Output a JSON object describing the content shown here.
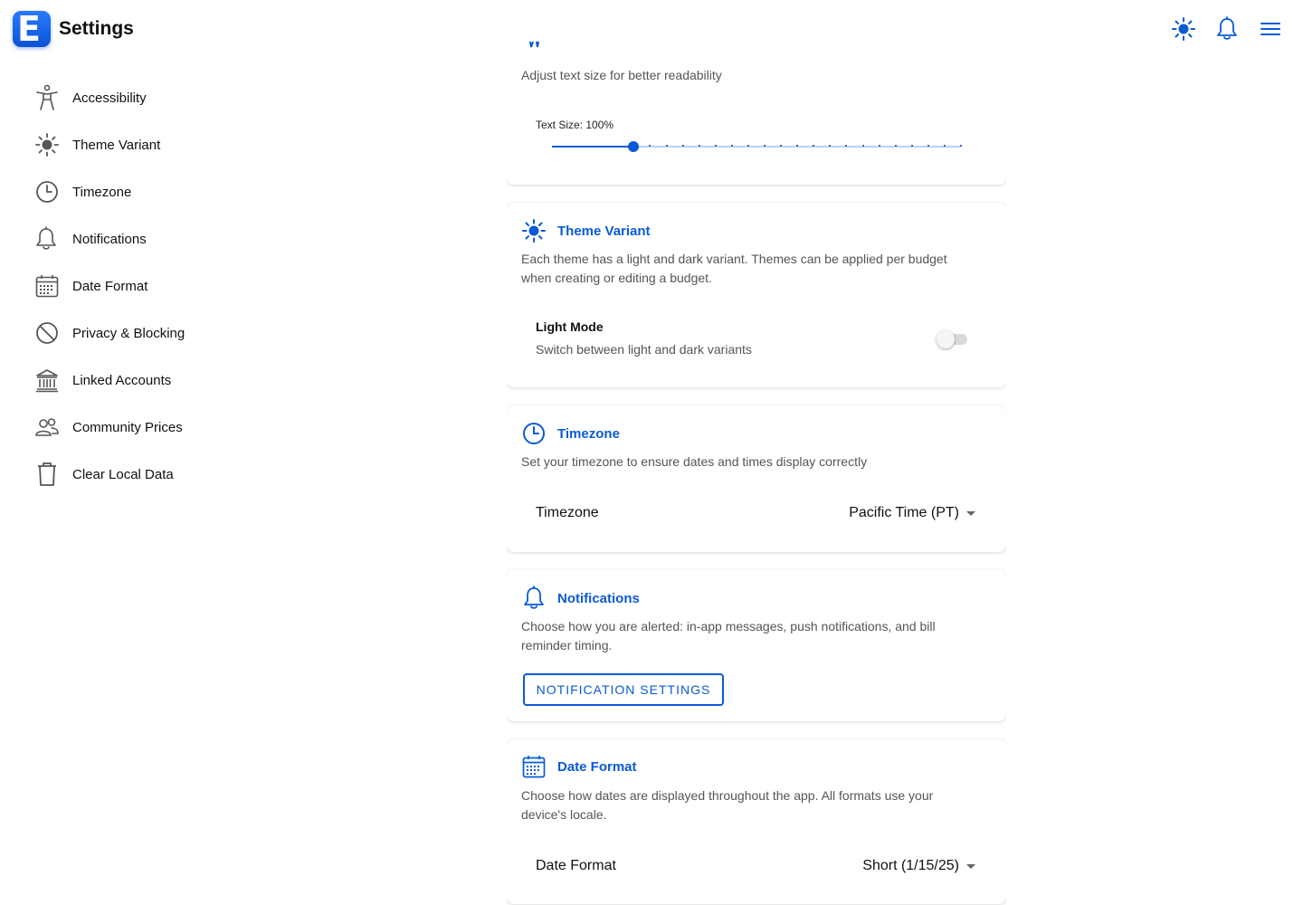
{
  "header": {
    "logo_letter": "E",
    "title": "Settings",
    "icons": [
      "sun-icon",
      "bell-icon",
      "menu-icon"
    ]
  },
  "colors": {
    "accent": "#0a5ad6",
    "text": "#111111",
    "muted": "#555555",
    "toggle_off": "#d9d9d9"
  },
  "sidebar": {
    "items": [
      {
        "label": "Accessibility",
        "icon": "accessibility-icon"
      },
      {
        "label": "Theme Variant",
        "icon": "sun-icon"
      },
      {
        "label": "Timezone",
        "icon": "clock-icon"
      },
      {
        "label": "Notifications",
        "icon": "bell-icon"
      },
      {
        "label": "Date Format",
        "icon": "calendar-icon"
      },
      {
        "label": "Privacy & Blocking",
        "icon": "block-icon"
      },
      {
        "label": "Linked Accounts",
        "icon": "bank-icon"
      },
      {
        "label": "Community Prices",
        "icon": "people-icon"
      },
      {
        "label": "Clear Local Data",
        "icon": "trash-icon"
      }
    ]
  },
  "accessibility": {
    "description": "Adjust text size for better readability",
    "slider_label": "Text Size: 100%",
    "slider_fraction": 0.2
  },
  "theme": {
    "title": "Theme Variant",
    "description": "Each theme has a light and dark variant. Themes can be applied per budget when creating or editing a budget.",
    "row_title": "Light Mode",
    "row_sub": "Switch between light and dark variants",
    "toggle_on": false
  },
  "timezone": {
    "title": "Timezone",
    "description": "Set your timezone to ensure dates and times display correctly",
    "field_label": "Timezone",
    "value": "Pacific Time (PT)"
  },
  "notifications": {
    "title": "Notifications",
    "description": "Choose how you are alerted: in-app messages, push notifications, and bill reminder timing.",
    "button_label": "NOTIFICATION SETTINGS"
  },
  "date_format": {
    "title": "Date Format",
    "description": "Choose how dates are displayed throughout the app. All formats use your device's locale.",
    "field_label": "Date Format",
    "value": "Short (1/15/25)"
  }
}
